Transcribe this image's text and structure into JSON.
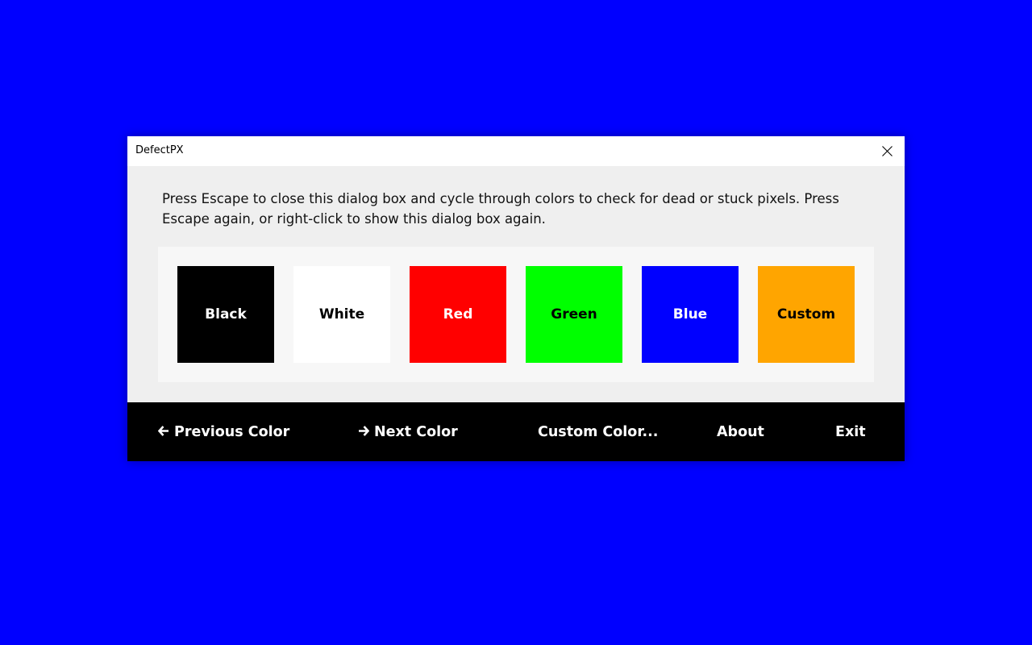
{
  "window": {
    "title": "DefectPX",
    "close_icon": "close-icon"
  },
  "message": "Press Escape to close this dialog box and cycle through colors to check for dead or stuck pixels. Press Escape again, or right-click to show this dialog box again.",
  "swatches": [
    {
      "label": "Black",
      "color": "#000000",
      "text_color": "#ffffff"
    },
    {
      "label": "White",
      "color": "#ffffff",
      "text_color": "#000000"
    },
    {
      "label": "Red",
      "color": "#ff0000",
      "text_color": "#ffffff"
    },
    {
      "label": "Green",
      "color": "#00ff00",
      "text_color": "#000000"
    },
    {
      "label": "Blue",
      "color": "#0000ff",
      "text_color": "#ffffff"
    },
    {
      "label": "Custom",
      "color": "#ffa500",
      "text_color": "#000000"
    }
  ],
  "toolbar": {
    "previous": {
      "label": "Previous Color",
      "icon": "arrow-left-icon",
      "glyph": "🡐"
    },
    "next": {
      "label": "Next Color",
      "icon": "arrow-right-icon",
      "glyph": "🡒"
    },
    "custom": {
      "label": "Custom Color..."
    },
    "about": {
      "label": "About"
    },
    "exit": {
      "label": "Exit"
    }
  },
  "background_color": "#0000ff"
}
